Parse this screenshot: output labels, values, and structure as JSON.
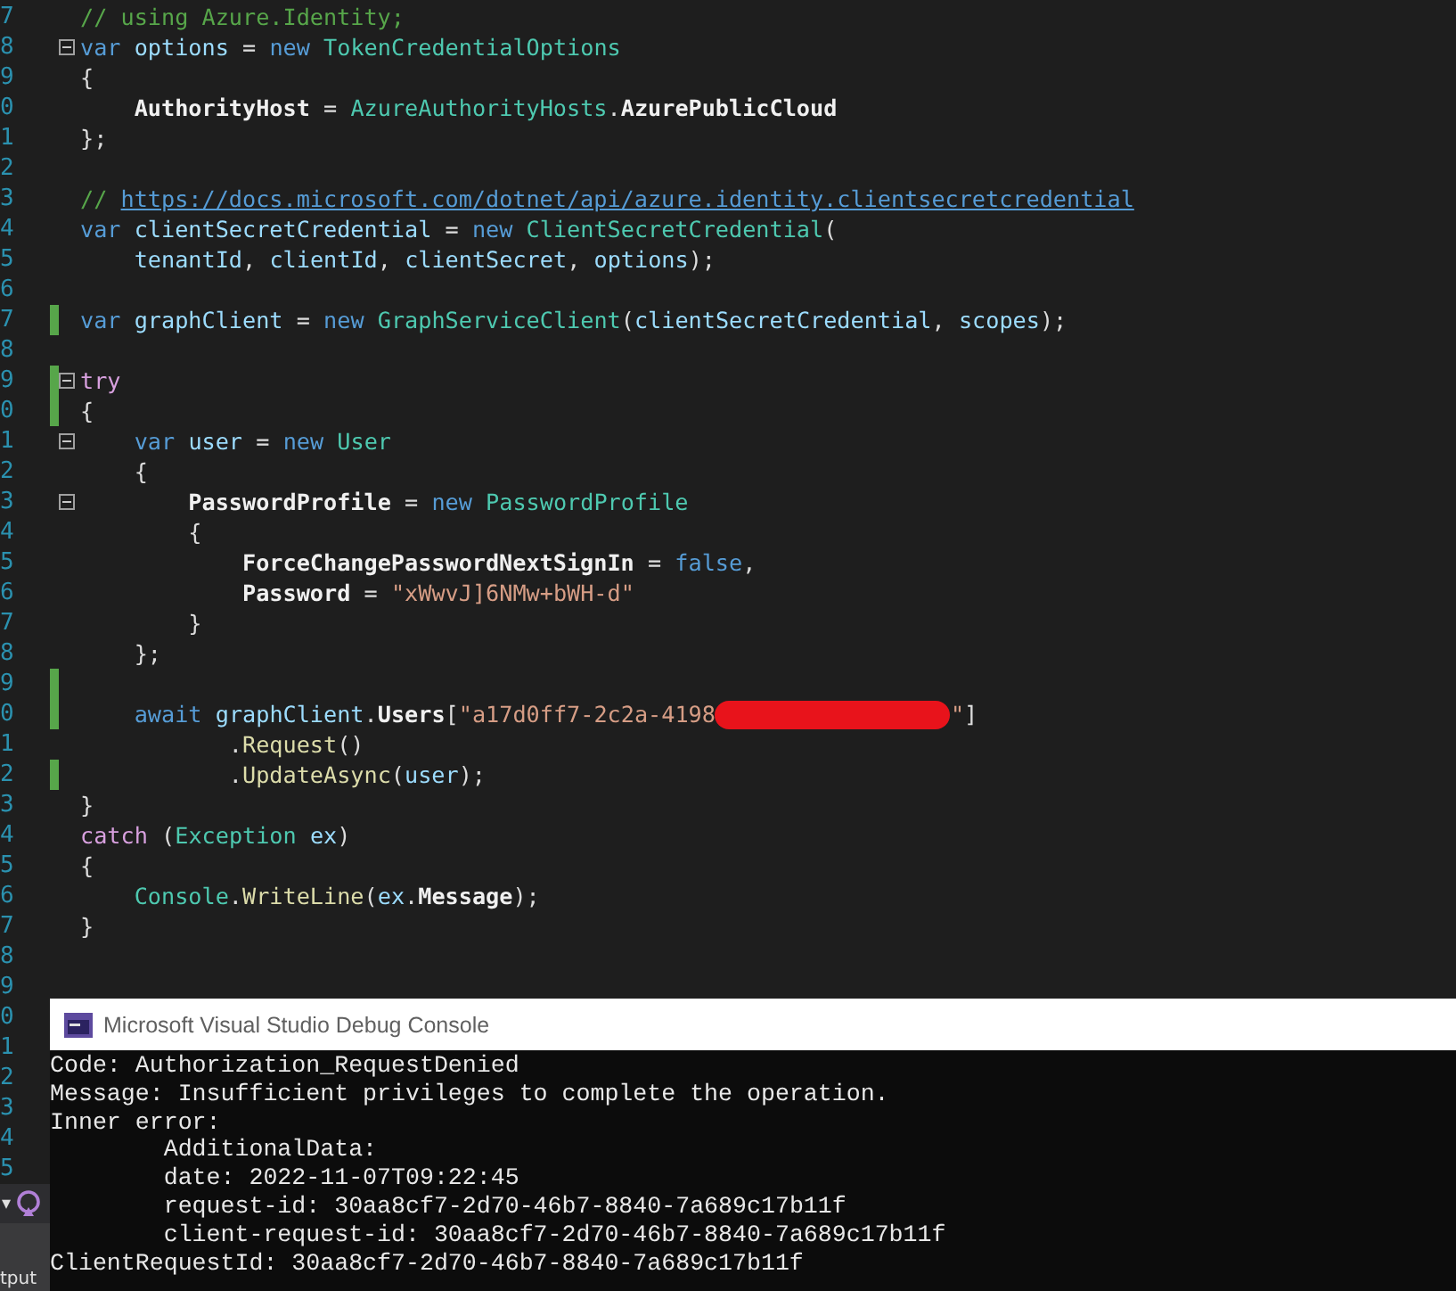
{
  "editor": {
    "lines": [
      {
        "number": "7",
        "changed": false,
        "fold": false,
        "kind": "code",
        "segments": [
          {
            "kind": "comment",
            "text": "// using Azure.Identity;"
          }
        ]
      },
      {
        "number": "8",
        "changed": false,
        "fold": true,
        "kind": "code",
        "segments": [
          {
            "kind": "keyword",
            "text": "var "
          },
          {
            "kind": "local",
            "text": "options"
          },
          {
            "kind": "plain",
            "text": " = "
          },
          {
            "kind": "keyword",
            "text": "new "
          },
          {
            "kind": "type",
            "text": "TokenCredentialOptions"
          }
        ]
      },
      {
        "number": "9",
        "changed": false,
        "fold": false,
        "kind": "code",
        "segments": [
          {
            "kind": "plain",
            "text": "{"
          }
        ]
      },
      {
        "number": "0",
        "changed": false,
        "fold": false,
        "kind": "code",
        "segments": [
          {
            "kind": "prop",
            "text": "AuthorityHost"
          },
          {
            "kind": "plain",
            "text": " = "
          },
          {
            "kind": "type",
            "text": "AzureAuthorityHosts"
          },
          {
            "kind": "plain",
            "text": "."
          },
          {
            "kind": "prop",
            "text": "AzurePublicCloud"
          }
        ]
      },
      {
        "number": "1",
        "changed": false,
        "fold": false,
        "kind": "code",
        "segments": [
          {
            "kind": "plain",
            "text": "};"
          }
        ]
      },
      {
        "number": "2",
        "changed": false,
        "fold": false,
        "kind": "code"
      },
      {
        "number": "3",
        "changed": false,
        "fold": false,
        "kind": "code",
        "segments": [
          {
            "kind": "comment",
            "text": "// "
          },
          {
            "kind": "link",
            "text": "https://docs.microsoft.com/dotnet/api/azure.identity.clientsecretcredential"
          }
        ]
      },
      {
        "number": "4",
        "changed": false,
        "fold": false,
        "kind": "code",
        "segments": [
          {
            "kind": "keyword",
            "text": "var "
          },
          {
            "kind": "local",
            "text": "clientSecretCredential"
          },
          {
            "kind": "plain",
            "text": " = "
          },
          {
            "kind": "keyword",
            "text": "new "
          },
          {
            "kind": "type",
            "text": "ClientSecretCredential"
          },
          {
            "kind": "plain",
            "text": "("
          }
        ]
      },
      {
        "number": "5",
        "changed": false,
        "fold": false,
        "kind": "wrapped",
        "segments": [
          {
            "kind": "local",
            "text": "tenantId"
          },
          {
            "kind": "plain",
            "text": ", "
          },
          {
            "kind": "local",
            "text": "clientId"
          },
          {
            "kind": "plain",
            "text": ", "
          },
          {
            "kind": "local",
            "text": "clientSecret"
          },
          {
            "kind": "plain",
            "text": ", "
          },
          {
            "kind": "local",
            "text": "options"
          },
          {
            "kind": "plain",
            "text": ");"
          }
        ]
      },
      {
        "number": "6",
        "changed": false,
        "fold": false,
        "kind": "code"
      },
      {
        "number": "7",
        "changed": true,
        "fold": false,
        "kind": "code",
        "segments": [
          {
            "kind": "keyword",
            "text": "var "
          },
          {
            "kind": "local",
            "text": "graphClient"
          },
          {
            "kind": "plain",
            "text": " = "
          },
          {
            "kind": "keyword",
            "text": "new "
          },
          {
            "kind": "type",
            "text": "GraphServiceClient"
          },
          {
            "kind": "plain",
            "text": "("
          },
          {
            "kind": "local",
            "text": "clientSecretCredential"
          },
          {
            "kind": "plain",
            "text": ", "
          },
          {
            "kind": "local",
            "text": "scopes"
          },
          {
            "kind": "plain",
            "text": ");"
          }
        ]
      },
      {
        "number": "8",
        "changed": false,
        "fold": false,
        "kind": "code"
      },
      {
        "number": "9",
        "changed": true,
        "fold": true,
        "kind": "code",
        "segments": [
          {
            "kind": "control",
            "text": "try"
          }
        ]
      },
      {
        "number": "0",
        "changed": true,
        "fold": false,
        "kind": "code",
        "segments": [
          {
            "kind": "plain",
            "text": "{"
          }
        ]
      },
      {
        "number": "1",
        "changed": false,
        "fold": true,
        "kind": "code",
        "segments": [
          {
            "kind": "keyword",
            "text": "var "
          },
          {
            "kind": "local",
            "text": "user"
          },
          {
            "kind": "plain",
            "text": " = "
          },
          {
            "kind": "keyword",
            "text": "new "
          },
          {
            "kind": "type",
            "text": "User"
          }
        ]
      },
      {
        "number": "2",
        "changed": false,
        "fold": false,
        "kind": "code",
        "segments": [
          {
            "kind": "plain",
            "text": "{"
          }
        ]
      },
      {
        "number": "3",
        "changed": false,
        "fold": true,
        "kind": "code",
        "segments": [
          {
            "kind": "prop",
            "text": "PasswordProfile"
          },
          {
            "kind": "plain",
            "text": " = "
          },
          {
            "kind": "keyword",
            "text": "new "
          },
          {
            "kind": "type",
            "text": "PasswordProfile"
          }
        ]
      },
      {
        "number": "4",
        "changed": false,
        "fold": false,
        "kind": "code",
        "segments": [
          {
            "kind": "plain",
            "text": "{"
          }
        ]
      },
      {
        "number": "5",
        "changed": false,
        "fold": false,
        "kind": "code",
        "segments": [
          {
            "kind": "prop",
            "text": "ForceChangePasswordNextSignIn"
          },
          {
            "kind": "plain",
            "text": " = "
          },
          {
            "kind": "keyword",
            "text": "false"
          },
          {
            "kind": "plain",
            "text": ","
          }
        ]
      },
      {
        "number": "6",
        "changed": false,
        "fold": false,
        "kind": "code",
        "segments": [
          {
            "kind": "prop",
            "text": "Password"
          },
          {
            "kind": "plain",
            "text": " = "
          },
          {
            "kind": "string",
            "text": "\"xWwvJ]6NMw+bWH-d\""
          }
        ]
      },
      {
        "number": "7",
        "changed": false,
        "fold": false,
        "kind": "code",
        "segments": [
          {
            "kind": "plain",
            "text": "}"
          }
        ]
      },
      {
        "number": "8",
        "changed": false,
        "fold": false,
        "kind": "code",
        "segments": [
          {
            "kind": "plain",
            "text": "};"
          }
        ]
      },
      {
        "number": "9",
        "changed": true,
        "fold": false,
        "kind": "code"
      },
      {
        "number": "0",
        "changed": true,
        "fold": false,
        "kind": "code",
        "segments": [
          {
            "kind": "keyword",
            "text": "await "
          },
          {
            "kind": "local",
            "text": "graphClient"
          },
          {
            "kind": "plain",
            "text": "."
          },
          {
            "kind": "prop",
            "text": "Users"
          },
          {
            "kind": "plain",
            "text": "["
          },
          {
            "kind": "string",
            "text": "\"a17d0ff7-2c2a-4198"
          },
          {
            "kind": "redaction"
          },
          {
            "kind": "string",
            "text": "\""
          },
          {
            "kind": "plain",
            "text": "]"
          }
        ]
      },
      {
        "number": "1",
        "changed": false,
        "fold": false,
        "kind": "chained",
        "segments": [
          {
            "kind": "plain",
            "text": "."
          },
          {
            "kind": "method",
            "text": "Request"
          },
          {
            "kind": "plain",
            "text": "()"
          }
        ]
      },
      {
        "number": "2",
        "changed": true,
        "fold": false,
        "kind": "chained",
        "segments": [
          {
            "kind": "plain",
            "text": "."
          },
          {
            "kind": "method",
            "text": "UpdateAsync"
          },
          {
            "kind": "plain",
            "text": "("
          },
          {
            "kind": "local",
            "text": "user"
          },
          {
            "kind": "plain",
            "text": ");"
          }
        ]
      },
      {
        "number": "3",
        "changed": false,
        "fold": false,
        "kind": "code",
        "segments": [
          {
            "kind": "plain",
            "text": "}"
          }
        ]
      },
      {
        "number": "4",
        "changed": false,
        "fold": false,
        "kind": "code",
        "segments": [
          {
            "kind": "control",
            "text": "catch"
          },
          {
            "kind": "plain",
            "text": " ("
          },
          {
            "kind": "type",
            "text": "Exception "
          },
          {
            "kind": "local",
            "text": "ex"
          },
          {
            "kind": "plain",
            "text": ")"
          }
        ]
      },
      {
        "number": "5",
        "changed": false,
        "fold": false,
        "kind": "code",
        "segments": [
          {
            "kind": "plain",
            "text": "{"
          }
        ]
      },
      {
        "number": "6",
        "changed": false,
        "fold": false,
        "kind": "code",
        "segments": [
          {
            "kind": "type",
            "text": "Console"
          },
          {
            "kind": "plain",
            "text": "."
          },
          {
            "kind": "method",
            "text": "WriteLine"
          },
          {
            "kind": "plain",
            "text": "("
          },
          {
            "kind": "local",
            "text": "ex"
          },
          {
            "kind": "plain",
            "text": "."
          },
          {
            "kind": "prop",
            "text": "Message"
          },
          {
            "kind": "plain",
            "text": ");"
          }
        ]
      },
      {
        "number": "7",
        "changed": false,
        "fold": false,
        "kind": "code",
        "segments": [
          {
            "kind": "plain",
            "text": "}"
          }
        ]
      },
      {
        "number": "8",
        "changed": false,
        "fold": false,
        "kind": "code"
      },
      {
        "number": "9",
        "changed": false,
        "fold": false,
        "kind": "code"
      },
      {
        "number": "0",
        "changed": false,
        "fold": false,
        "kind": "code"
      },
      {
        "number": "1",
        "changed": false,
        "fold": false,
        "kind": "code"
      },
      {
        "number": "2",
        "changed": false,
        "fold": false,
        "kind": "code"
      },
      {
        "number": "3",
        "changed": false,
        "fold": false,
        "kind": "code"
      },
      {
        "number": "4",
        "changed": false,
        "fold": false,
        "kind": "code"
      },
      {
        "number": "5",
        "changed": false,
        "fold": false,
        "kind": "code"
      }
    ]
  },
  "bottom_panel": {
    "dropdown": "▾",
    "tab": "tput"
  },
  "console": {
    "title": "Microsoft Visual Studio Debug Console",
    "lines": [
      "Code: Authorization_RequestDenied",
      "Message: Insufficient privileges to complete the operation.",
      "Inner error:",
      "\tAdditionalData:",
      "\tdate: 2022-11-07T09:22:45",
      "\trequest-id: 30aa8cf7-2d70-46b7-8840-7a689c17b11f",
      "\tclient-request-id: 30aa8cf7-2d70-46b7-8840-7a689c17b11f",
      "ClientRequestId: 30aa8cf7-2d70-46b7-8840-7a689c17b11f"
    ]
  }
}
